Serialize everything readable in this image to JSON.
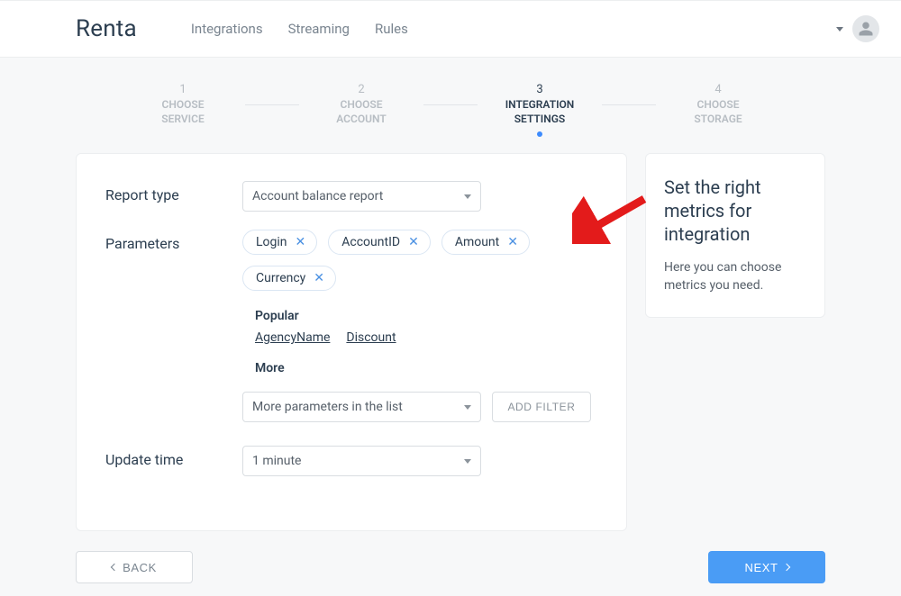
{
  "header": {
    "logo": "Renta",
    "nav": [
      "Integrations",
      "Streaming",
      "Rules"
    ]
  },
  "stepper": {
    "steps": [
      {
        "num": "1",
        "label": "CHOOSE\nSERVICE"
      },
      {
        "num": "2",
        "label": "CHOOSE\nACCOUNT"
      },
      {
        "num": "3",
        "label": "INTEGRATION\nSETTINGS"
      },
      {
        "num": "4",
        "label": "CHOOSE\nSTORAGE"
      }
    ],
    "active_index": 2
  },
  "form": {
    "report_type_label": "Report type",
    "report_type_value": "Account balance report",
    "parameters_label": "Parameters",
    "selected_params": [
      "Login",
      "AccountID",
      "Amount",
      "Currency"
    ],
    "popular_heading": "Popular",
    "popular_items": [
      "AgencyName",
      "Discount"
    ],
    "more_heading": "More",
    "more_placeholder": "More parameters in the list",
    "add_filter_label": "ADD FILTER",
    "update_time_label": "Update time",
    "update_time_value": "1 minute"
  },
  "sidebar": {
    "title": "Set the right metrics for integration",
    "text": "Here you can choose metrics you need."
  },
  "footer": {
    "back_label": "BACK",
    "next_label": "NEXT"
  }
}
